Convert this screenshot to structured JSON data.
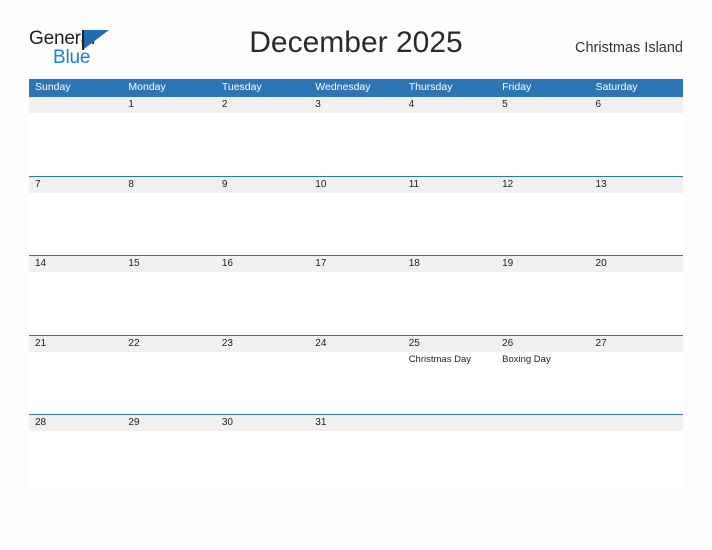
{
  "brand": {
    "line1": "General",
    "line2": "Blue",
    "flag_icon": "blue-triangle-flag-icon",
    "accent_color": "#1f7fd1"
  },
  "header": {
    "title": "December 2025",
    "region": "Christmas Island"
  },
  "colors": {
    "header_blue": "#2e75b6",
    "date_band_gray": "#f0f0f0",
    "text_dark": "#222222",
    "page_background": "#fdfdfd"
  },
  "calendar": {
    "weekday_headers": [
      "Sunday",
      "Monday",
      "Tuesday",
      "Wednesday",
      "Thursday",
      "Friday",
      "Saturday"
    ],
    "weeks": [
      {
        "days": [
          {
            "date": "",
            "event": ""
          },
          {
            "date": "1",
            "event": ""
          },
          {
            "date": "2",
            "event": ""
          },
          {
            "date": "3",
            "event": ""
          },
          {
            "date": "4",
            "event": ""
          },
          {
            "date": "5",
            "event": ""
          },
          {
            "date": "6",
            "event": ""
          }
        ]
      },
      {
        "days": [
          {
            "date": "7",
            "event": ""
          },
          {
            "date": "8",
            "event": ""
          },
          {
            "date": "9",
            "event": ""
          },
          {
            "date": "10",
            "event": ""
          },
          {
            "date": "11",
            "event": ""
          },
          {
            "date": "12",
            "event": ""
          },
          {
            "date": "13",
            "event": ""
          }
        ]
      },
      {
        "days": [
          {
            "date": "14",
            "event": ""
          },
          {
            "date": "15",
            "event": ""
          },
          {
            "date": "16",
            "event": ""
          },
          {
            "date": "17",
            "event": ""
          },
          {
            "date": "18",
            "event": ""
          },
          {
            "date": "19",
            "event": ""
          },
          {
            "date": "20",
            "event": ""
          }
        ]
      },
      {
        "days": [
          {
            "date": "21",
            "event": ""
          },
          {
            "date": "22",
            "event": ""
          },
          {
            "date": "23",
            "event": ""
          },
          {
            "date": "24",
            "event": ""
          },
          {
            "date": "25",
            "event": "Christmas Day"
          },
          {
            "date": "26",
            "event": "Boxing Day"
          },
          {
            "date": "27",
            "event": ""
          }
        ]
      },
      {
        "days": [
          {
            "date": "28",
            "event": ""
          },
          {
            "date": "29",
            "event": ""
          },
          {
            "date": "30",
            "event": ""
          },
          {
            "date": "31",
            "event": ""
          },
          {
            "date": "",
            "event": ""
          },
          {
            "date": "",
            "event": ""
          },
          {
            "date": "",
            "event": ""
          }
        ]
      }
    ]
  }
}
